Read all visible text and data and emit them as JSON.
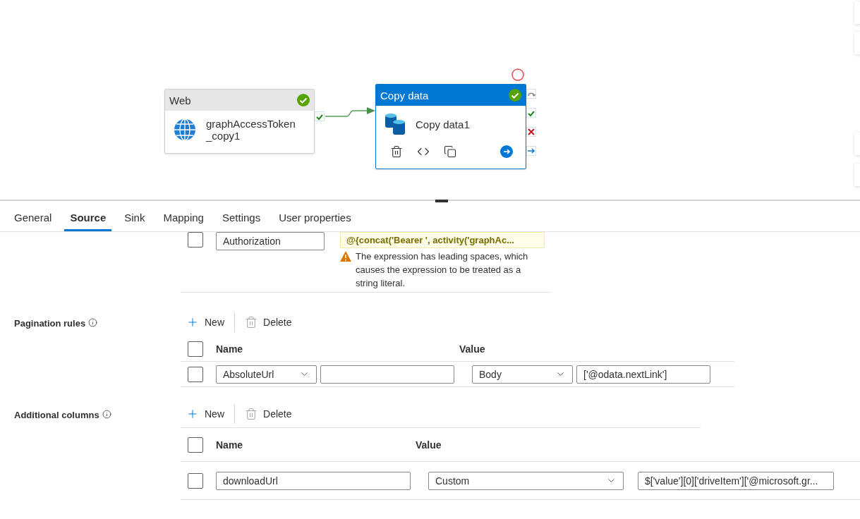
{
  "canvas": {
    "activities": [
      {
        "kind": "web",
        "type": "Web",
        "name": "graphAccessToken_copy1",
        "selected": false,
        "succeeded": true
      },
      {
        "kind": "copy",
        "type": "Copy data",
        "name": "Copy data1",
        "selected": true,
        "succeeded": true
      }
    ]
  },
  "tabs": [
    {
      "label": "General",
      "selected": false
    },
    {
      "label": "Source",
      "selected": true
    },
    {
      "label": "Sink",
      "selected": false
    },
    {
      "label": "Mapping",
      "selected": false
    },
    {
      "label": "Settings",
      "selected": false
    },
    {
      "label": "User properties",
      "selected": false
    }
  ],
  "headers_row": {
    "checked": false,
    "name": "Authorization",
    "tooltip": "@{concat('Bearer ', activity('graphAc...",
    "warning": "The expression has leading spaces, which causes the expression to be treated as a string literal."
  },
  "pagination_rules": {
    "label": "Pagination rules",
    "new": "New",
    "delete": "Delete",
    "all_checked": false,
    "columns": [
      "Name",
      "Value"
    ],
    "rows": [
      {
        "checked": false,
        "name": "AbsoluteUrl",
        "value_type": "Body",
        "value": "['@odata.nextLink']"
      }
    ]
  },
  "additional_columns": {
    "label": "Additional columns",
    "new": "New",
    "delete": "Delete",
    "all_checked": false,
    "columns": [
      "Name",
      "Value"
    ],
    "rows": [
      {
        "checked": false,
        "name": "downloadUrl",
        "value_type": "Custom",
        "value": "$['value'][0]['driveItem']['@microsoft.gr..."
      }
    ]
  }
}
